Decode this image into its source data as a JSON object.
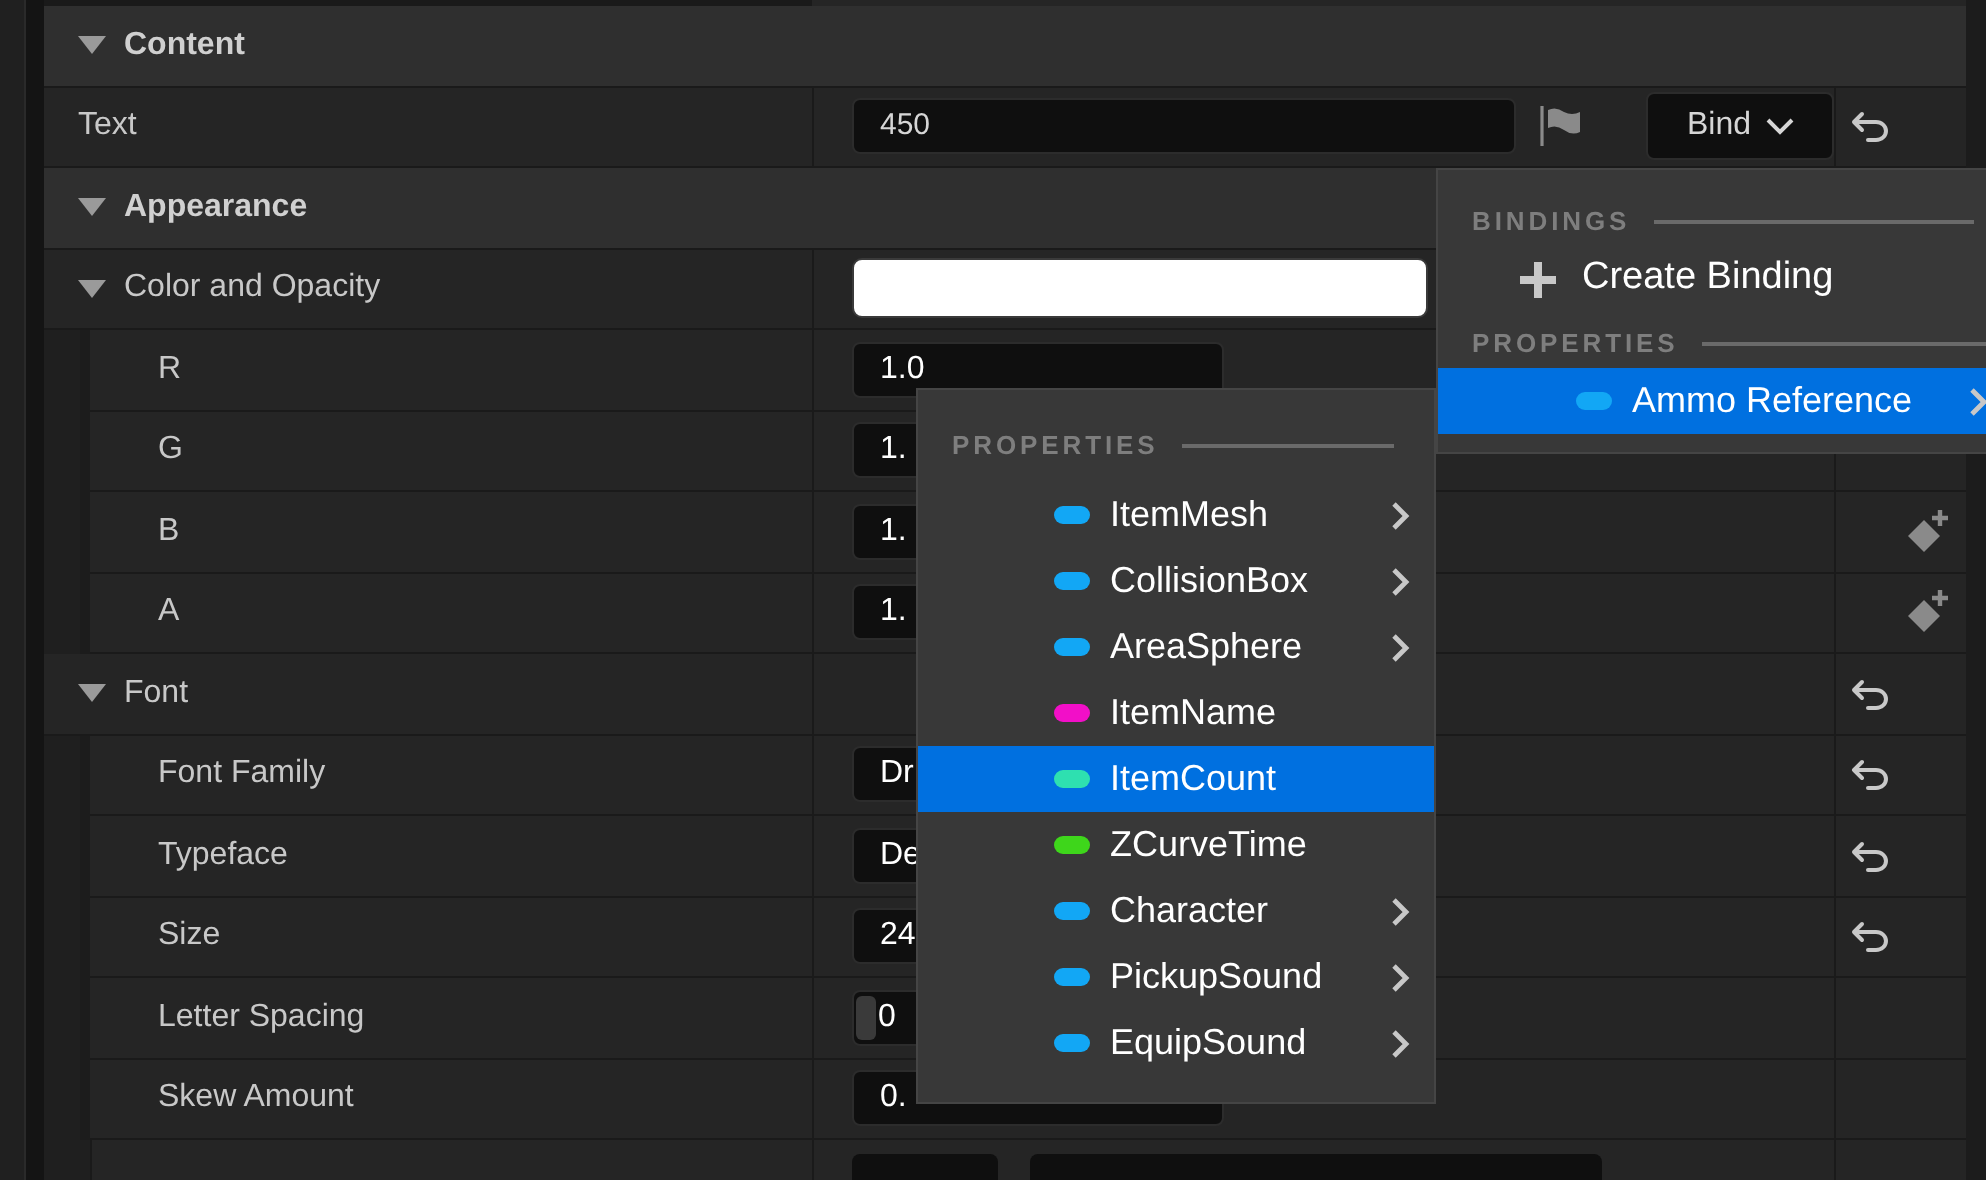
{
  "sections": [
    {
      "title": "Content",
      "expanded": true,
      "properties": [
        {
          "label": "Text",
          "kind": "text",
          "value": "450",
          "bind_label": "Bind",
          "reset": true
        }
      ]
    },
    {
      "title": "Appearance",
      "expanded": true,
      "properties": [
        {
          "label": "Color and Opacity",
          "kind": "color",
          "expanded": true,
          "children": [
            {
              "label": "R",
              "kind": "field",
              "value": "1.0"
            },
            {
              "label": "G",
              "kind": "field",
              "value": "1."
            },
            {
              "label": "B",
              "kind": "field",
              "value": "1.",
              "keyframe": true
            },
            {
              "label": "A",
              "kind": "field",
              "value": "1.",
              "keyframe": true
            }
          ]
        },
        {
          "label": "Font",
          "kind": "group",
          "expanded": true,
          "reset": true,
          "children": [
            {
              "label": "Font Family",
              "kind": "field",
              "value": "Dr",
              "reset": true
            },
            {
              "label": "Typeface",
              "kind": "field",
              "value": "De",
              "reset": true
            },
            {
              "label": "Size",
              "kind": "field",
              "value": "24",
              "reset": true
            },
            {
              "label": "Letter Spacing",
              "kind": "slider",
              "value": "0"
            },
            {
              "label": "Skew Amount",
              "kind": "field",
              "value": "0."
            }
          ]
        }
      ]
    }
  ],
  "binding_menu": {
    "sections": [
      {
        "heading": "BINDINGS",
        "items": [
          {
            "kind": "action",
            "label": "Create Binding",
            "selected": false
          }
        ]
      },
      {
        "heading": "PROPERTIES",
        "items": [
          {
            "kind": "property",
            "label": "Ammo Reference",
            "color": "#12a7f5",
            "selected": true,
            "submenu": true
          }
        ]
      }
    ]
  },
  "properties_menu": {
    "heading": "PROPERTIES",
    "items": [
      {
        "label": "ItemMesh",
        "color": "#12a7f5",
        "selected": false,
        "submenu": true
      },
      {
        "label": "CollisionBox",
        "color": "#12a7f5",
        "selected": false,
        "submenu": true
      },
      {
        "label": "AreaSphere",
        "color": "#12a7f5",
        "selected": false,
        "submenu": true
      },
      {
        "label": "ItemName",
        "color": "#f20fc8",
        "selected": false,
        "submenu": false
      },
      {
        "label": "ItemCount",
        "color": "#2ee0b0",
        "selected": true,
        "submenu": false
      },
      {
        "label": "ZCurveTime",
        "color": "#3ed61b",
        "selected": false,
        "submenu": false
      },
      {
        "label": "Character",
        "color": "#12a7f5",
        "selected": false,
        "submenu": true
      },
      {
        "label": "PickupSound",
        "color": "#12a7f5",
        "selected": false,
        "submenu": true
      },
      {
        "label": "EquipSound",
        "color": "#12a7f5",
        "selected": false,
        "submenu": true
      }
    ]
  }
}
